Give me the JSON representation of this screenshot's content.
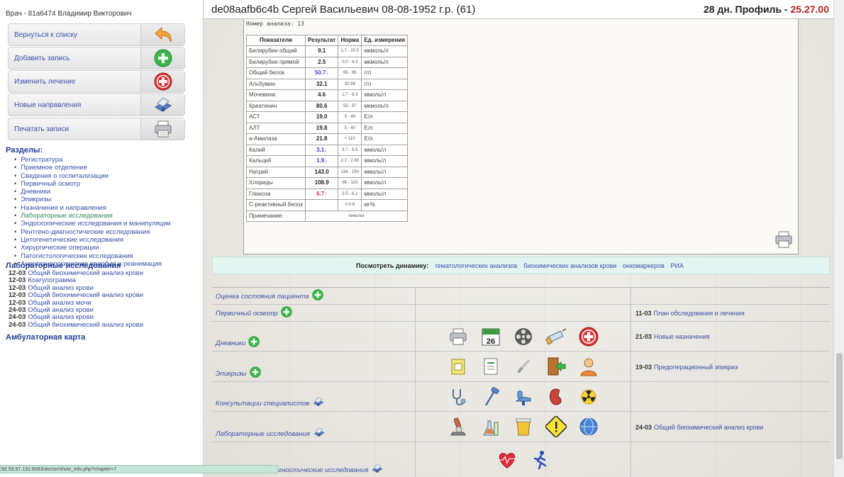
{
  "doctor": "Врач - 81а6474 Владимир Викторович",
  "nav": [
    {
      "label": "Вернуться к списку",
      "icon": "back-arrow-icon"
    },
    {
      "label": "Добавить запись",
      "icon": "add-plus-icon"
    },
    {
      "label": "Изменить лечение",
      "icon": "medical-cross-icon"
    },
    {
      "label": "Новые направления",
      "icon": "referral-stamp-icon"
    },
    {
      "label": "Печатать записи",
      "icon": "printer-icon"
    }
  ],
  "sections": {
    "title": "Разделы:",
    "items": [
      "Регистратура",
      "Приемное отделение",
      "Сведения о госпитализации",
      "Первичный осмотр",
      "Дневники",
      "Эпикризы",
      "Назначения и направления",
      "Лабораторные исследования",
      "Эндоскопические исследования и манипуляции",
      "Рентгено-диагностические исследования",
      "Цитогенетические исследования",
      "Хирургические операции",
      "Патогистологические исследования",
      "Анестезиологические пособия и реанимация"
    ],
    "active_index": 7
  },
  "lab_section": {
    "title": "Лабораторные исследования",
    "items": [
      {
        "date": "12-03",
        "text": "Общий биохимический анализ крови"
      },
      {
        "date": "12-03",
        "text": "Коагулограмма"
      },
      {
        "date": "12-03",
        "text": "Общий анализ крови"
      },
      {
        "date": "12-03",
        "text": "Общий биохимический анализ крови"
      },
      {
        "date": "12-03",
        "text": "Общий анализ мочи"
      },
      {
        "date": "24-03",
        "text": "Общий анализ крови"
      },
      {
        "date": "24-03",
        "text": "Общий анализ крови"
      },
      {
        "date": "24-03",
        "text": "Общий биохимический анализ крови"
      }
    ]
  },
  "ambulatory": "Амбулаторная карта",
  "status_url": "92.53.97.131:8083/doctor/show_info.php?chapter=7",
  "header": {
    "patient": "de08aafb6c4b Сергей Васильевич 08-08-1952 г.р. (61)",
    "days": "28 дн. Профиль - ",
    "profile": "25.27.00"
  },
  "report": {
    "analysis_number": "Номер анализа: 13",
    "columns": [
      "Показатели",
      "Результат",
      "Норма",
      "Ед. измерения"
    ],
    "rows": [
      {
        "name": "Билирубин общий",
        "result": "9.1",
        "flag": "",
        "norm": "1.7 - 20.5",
        "unit": "мкмоль/л"
      },
      {
        "name": "Билирубин прямой",
        "result": "2.5",
        "flag": "",
        "norm": "0.0 - 4.3",
        "unit": "мкмоль/л"
      },
      {
        "name": "Общий белок",
        "result": "50.7↓",
        "flag": "low",
        "norm": "65 - 85",
        "unit": "г/л"
      },
      {
        "name": "Альбумин",
        "result": "32.1",
        "flag": "",
        "norm": "32-56",
        "unit": "г/л"
      },
      {
        "name": "Мочевина",
        "result": "4.6",
        "flag": "",
        "norm": "1.7 - 8.3",
        "unit": "ммоль/л"
      },
      {
        "name": "Креатинин",
        "result": "80.6",
        "flag": "",
        "norm": "53 - 97",
        "unit": "мкмоль/л"
      },
      {
        "name": "АСТ",
        "result": "19.0",
        "flag": "",
        "norm": "5 - 40",
        "unit": "Е/л"
      },
      {
        "name": "АЛТ",
        "result": "19.8",
        "flag": "",
        "norm": "5 - 40",
        "unit": "Е/л"
      },
      {
        "name": "а-Амилаза",
        "result": "21.8",
        "flag": "",
        "norm": "< 110",
        "unit": "Е/л"
      },
      {
        "name": "Калий",
        "result": "3.1↓",
        "flag": "low",
        "norm": "3.7 - 5.5",
        "unit": "ммоль/л"
      },
      {
        "name": "Кальций",
        "result": "1.9↓",
        "flag": "low",
        "norm": "2.2 - 2.65",
        "unit": "ммоль/л"
      },
      {
        "name": "Натрий",
        "result": "143.0",
        "flag": "",
        "norm": "134 - 150",
        "unit": "ммоль/л"
      },
      {
        "name": "Хлориды",
        "result": "108.9",
        "flag": "",
        "norm": "95 - 110",
        "unit": "ммоль/л"
      },
      {
        "name": "Глюкоза",
        "result": "6.7↑",
        "flag": "high",
        "norm": "3.5 - 6.1",
        "unit": "ммоль/л"
      },
      {
        "name": "С-реактивный белок",
        "result": "",
        "flag": "",
        "norm": "0-0.8",
        "unit": "мг%"
      }
    ],
    "note_label": "Примечание:",
    "note_value": "гемолиз"
  },
  "dynamics": {
    "label": "Посмотреть динамику:",
    "links": [
      "гематологических анализов",
      "биохимических анализов крови",
      "онкомаркеров",
      "РИА"
    ]
  },
  "grid_rows": [
    {
      "label": "Оценка состояния пациента",
      "label_icon": "add-plus-icon",
      "icons": [],
      "note_date": "",
      "note_text": ""
    },
    {
      "label": "Первичный осмотр",
      "label_icon": "add-plus-icon",
      "icons": [],
      "note_date": "11-03",
      "note_text": "План обследования и лечения"
    },
    {
      "label": "Дневники",
      "label_icon": "add-plus-icon",
      "icons": [
        "printer-icon",
        "calendar-icon",
        "film-reel-icon",
        "syringe-icon",
        "medical-cross-icon"
      ],
      "calendar_day": "26",
      "note_date": "21-03",
      "note_text": "Новые назначения"
    },
    {
      "label": "Эпикризы",
      "label_icon": "add-plus-icon",
      "icons": [
        "notepad-icon",
        "document-list-icon",
        "scalpel-icon",
        "exit-door-icon",
        "doctor-icon"
      ],
      "note_date": "19-03",
      "note_text": "Предоперационный эпикриз"
    },
    {
      "label": "Консультации специалистов",
      "label_icon": "referral-stamp-icon",
      "icons": [
        "stethoscope-icon",
        "reflex-hammer-icon",
        "dental-chair-icon",
        "kidney-icon",
        "radiation-icon"
      ],
      "note_date": "",
      "note_text": ""
    },
    {
      "label": "Лабораторные исследования",
      "label_icon": "referral-stamp-icon",
      "icons": [
        "microscope-icon",
        "lab-flasks-icon",
        "urine-cup-icon",
        "warning-sign-icon",
        "globe-icon"
      ],
      "note_date": "24-03",
      "note_text": "Общий биохимический анализ крови"
    },
    {
      "label": "Функционально-диагностические исследования",
      "label_icon": "referral-stamp-icon",
      "icons": [
        "heart-icon",
        "runner-icon"
      ],
      "note_date": "",
      "note_text": ""
    }
  ],
  "colors": {
    "link": "#3a4fa8",
    "accent_red": "#b32020",
    "low": "#3b3fd6",
    "high": "#d63b3b"
  }
}
